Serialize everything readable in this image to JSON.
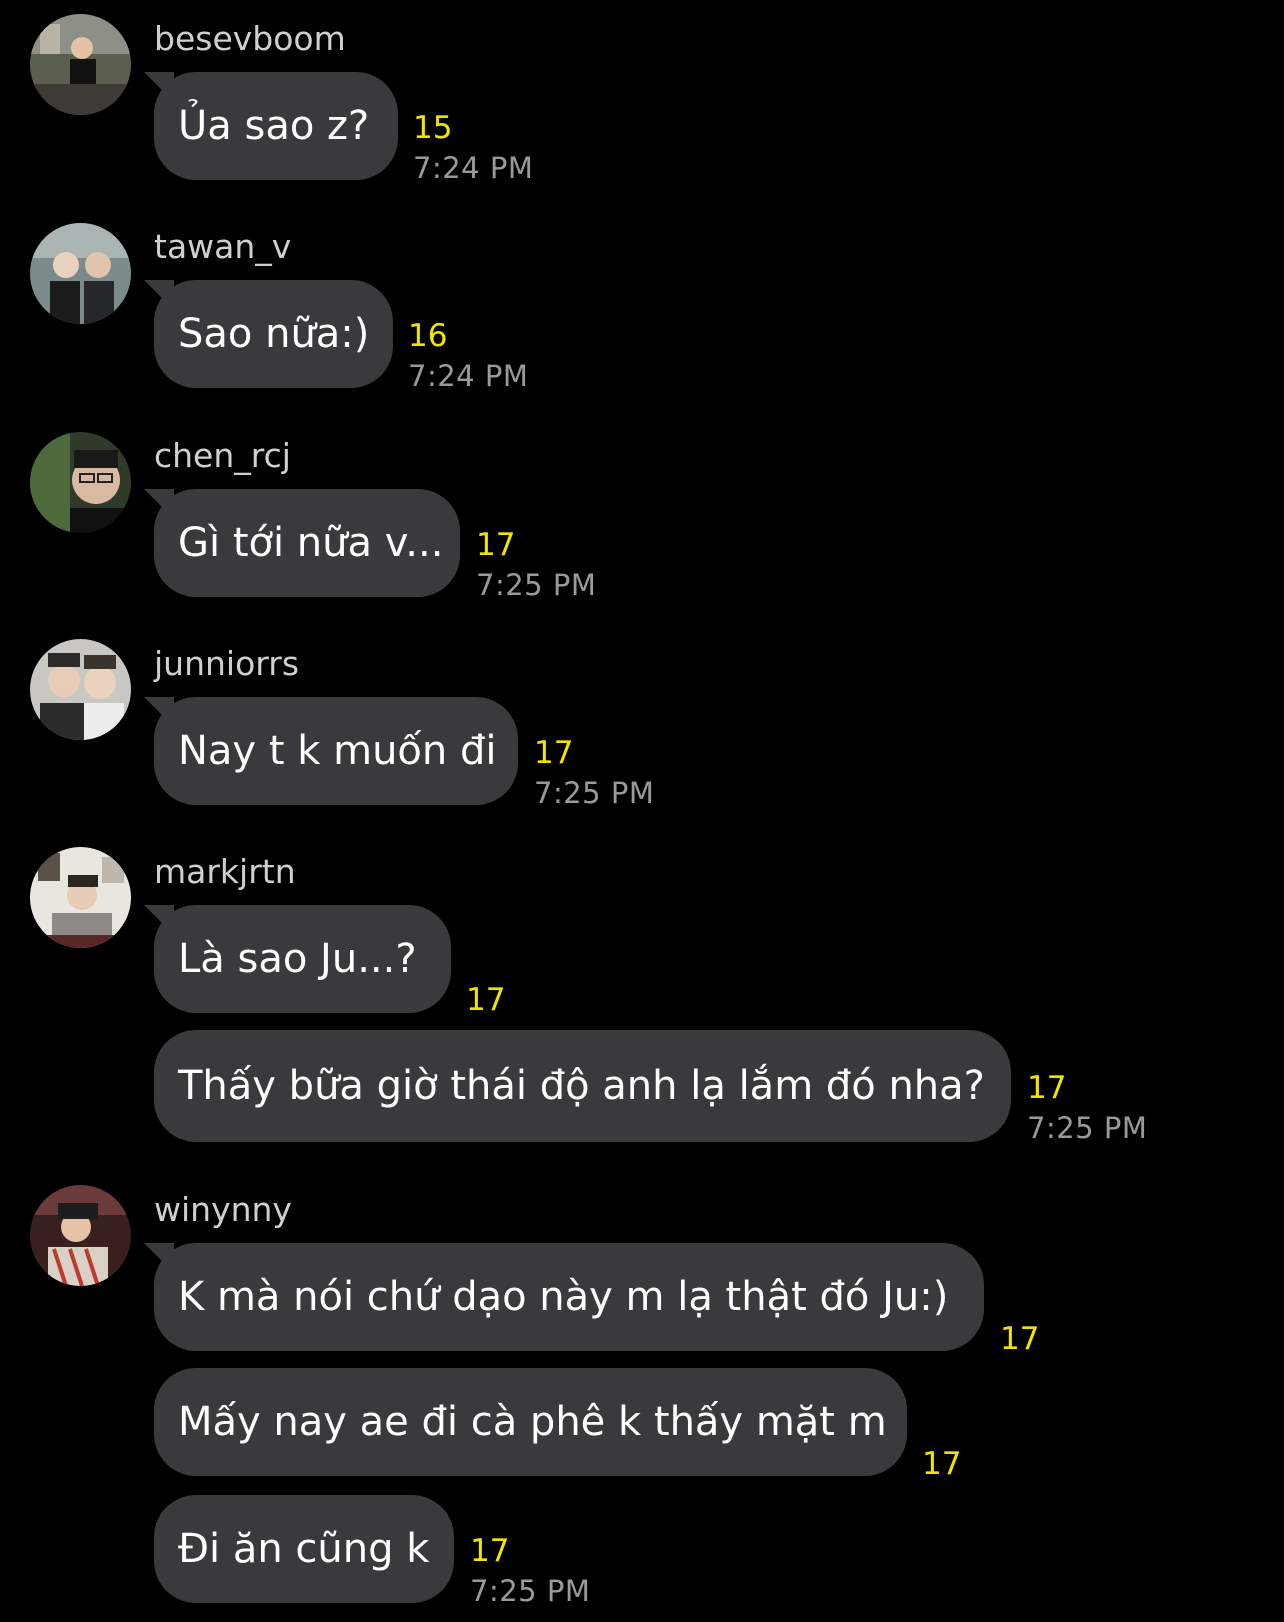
{
  "theme": {
    "background": "#000000",
    "bubble_color": "#3a3a3c",
    "count_color": "#f5e400",
    "time_color": "#9a9a9a",
    "username_color": "#cfcfcf"
  },
  "groups": [
    {
      "username": "besevboom",
      "avatar_icon": "avatar-photo",
      "messages": [
        {
          "text": "Ủa sao z?",
          "count": "15",
          "time": "7:24 PM"
        }
      ]
    },
    {
      "username": "tawan_v",
      "avatar_icon": "avatar-photo",
      "messages": [
        {
          "text": "Sao nữa:)",
          "count": "16",
          "time": "7:24 PM"
        }
      ]
    },
    {
      "username": "chen_rcj",
      "avatar_icon": "avatar-photo",
      "messages": [
        {
          "text": "Gì tới nữa v...",
          "count": "17",
          "time": "7:25 PM"
        }
      ]
    },
    {
      "username": "junniorrs",
      "avatar_icon": "avatar-photo",
      "messages": [
        {
          "text": "Nay t k muốn đi",
          "count": "17",
          "time": "7:25 PM"
        }
      ]
    },
    {
      "username": "markjrtn",
      "avatar_icon": "avatar-photo",
      "messages": [
        {
          "text": "Là sao Ju...?",
          "count": "17",
          "time": ""
        },
        {
          "text": "Thấy bữa giờ thái độ anh lạ lắm đó nha?",
          "count": "17",
          "time": "7:25 PM"
        }
      ]
    },
    {
      "username": "winynny",
      "avatar_icon": "avatar-photo",
      "messages": [
        {
          "text": "K mà nói chứ dạo này m lạ thật đó Ju:)",
          "count": "17",
          "time": ""
        },
        {
          "text": "Mấy nay ae đi cà phê k thấy mặt m",
          "count": "17",
          "time": ""
        },
        {
          "text": "Đi ăn cũng k",
          "count": "17",
          "time": "7:25 PM"
        }
      ]
    }
  ]
}
